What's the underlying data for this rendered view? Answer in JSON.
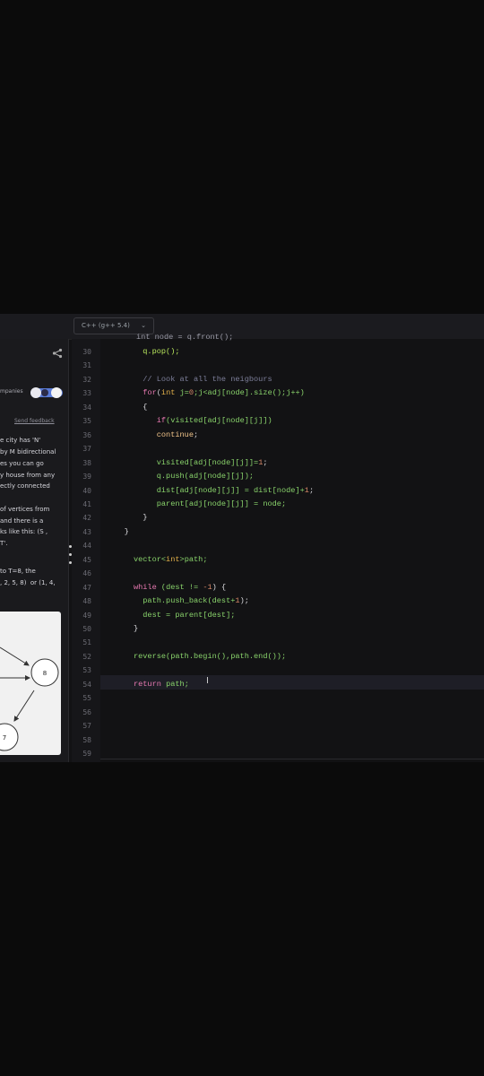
{
  "toolbar": {
    "language": "C++ (g++ 5.4)"
  },
  "panel": {
    "companies_label": "mpanies",
    "feedback": "Send feedback",
    "desc_lines": [
      "e city has 'N'",
      "by M bidirectional",
      "es you can go",
      "y house from any",
      "ectly connected",
      "",
      "of vertices from",
      "and there is a",
      "ks like this: (S ,",
      "T'.",
      "",
      "to T=8, the",
      ", 2, 5, 8)  or (1, 4,"
    ],
    "graph_nodes": [
      "8",
      "7"
    ]
  },
  "editor": {
    "line_numbers": [
      "30",
      "31",
      "32",
      "33",
      "34",
      "35",
      "36",
      "37",
      "38",
      "39",
      "40",
      "41",
      "42",
      "43",
      "44",
      "45",
      "46",
      "47",
      "48",
      "49",
      "50",
      "51",
      "52",
      "53",
      "54",
      "55",
      "56",
      "57",
      "58",
      "59"
    ],
    "partial_top": "int node = q.front();",
    "lines": [
      [
        {
          "t": "        q.pop();",
          "c": "var"
        }
      ],
      [],
      [
        {
          "t": "        // Look at all the neigbours",
          "c": "cm"
        }
      ],
      [
        {
          "t": "        ",
          "c": "op"
        },
        {
          "t": "for",
          "c": "kw"
        },
        {
          "t": "(",
          "c": "op"
        },
        {
          "t": "int",
          "c": "ty"
        },
        {
          "t": " j=",
          "c": "gr"
        },
        {
          "t": "0",
          "c": "num"
        },
        {
          "t": ";j<adj[node].size();j++)",
          "c": "gr"
        }
      ],
      [
        {
          "t": "        {",
          "c": "op"
        }
      ],
      [
        {
          "t": "           ",
          "c": "op"
        },
        {
          "t": "if",
          "c": "kw"
        },
        {
          "t": "(visited[adj[node][j]])",
          "c": "gr"
        }
      ],
      [
        {
          "t": "           ",
          "c": "op"
        },
        {
          "t": "continue",
          "c": "fn"
        },
        {
          "t": ";",
          "c": "op"
        }
      ],
      [],
      [
        {
          "t": "           visited[adj[node][j]]=",
          "c": "gr"
        },
        {
          "t": "1",
          "c": "num"
        },
        {
          "t": ";",
          "c": "op"
        }
      ],
      [
        {
          "t": "           q.push(adj[node][j]);",
          "c": "gr"
        }
      ],
      [
        {
          "t": "           dist[adj[node][j]] = dist[node]+",
          "c": "gr"
        },
        {
          "t": "1",
          "c": "num"
        },
        {
          "t": ";",
          "c": "op"
        }
      ],
      [
        {
          "t": "           parent[adj[node][j]] = node;",
          "c": "gr"
        }
      ],
      [
        {
          "t": "        }",
          "c": "op"
        }
      ],
      [
        {
          "t": "    }",
          "c": "op"
        }
      ],
      [],
      [
        {
          "t": "      vector<",
          "c": "gr"
        },
        {
          "t": "int",
          "c": "ty"
        },
        {
          "t": ">path;",
          "c": "gr"
        }
      ],
      [],
      [
        {
          "t": "      ",
          "c": "op"
        },
        {
          "t": "while",
          "c": "kw"
        },
        {
          "t": " (dest != ",
          "c": "gr"
        },
        {
          "t": "-1",
          "c": "num"
        },
        {
          "t": ") {",
          "c": "op"
        }
      ],
      [
        {
          "t": "        path.push_back(dest+",
          "c": "gr"
        },
        {
          "t": "1",
          "c": "num"
        },
        {
          "t": ");",
          "c": "op"
        }
      ],
      [
        {
          "t": "        dest = parent[dest];",
          "c": "gr"
        }
      ],
      [
        {
          "t": "      }",
          "c": "op"
        }
      ],
      [],
      [
        {
          "t": "      reverse(path.begin(),path.end());",
          "c": "gr"
        }
      ],
      [],
      [
        {
          "t": "      ",
          "c": "op"
        },
        {
          "t": "return",
          "c": "kw"
        },
        {
          "t": " path;",
          "c": "gr"
        }
      ],
      [],
      [],
      [],
      [],
      []
    ]
  }
}
